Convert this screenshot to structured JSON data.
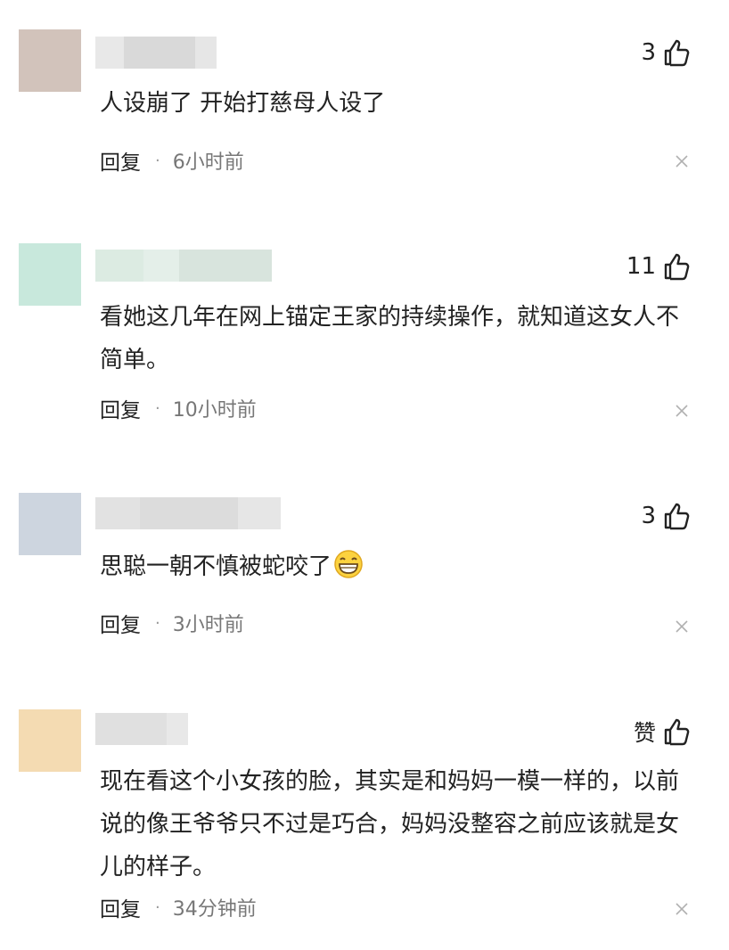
{
  "actions": {
    "reply_label": "回复",
    "separator": "·"
  },
  "comments": [
    {
      "likes": "3",
      "text": "人设崩了 开始打慈母人设了",
      "time": "6小时前",
      "avatar_color": "#d2c3bb"
    },
    {
      "likes": "11",
      "text": "看她这几年在网上锚定王家的持续操作，就知道这女人不简单。",
      "time": "10小时前",
      "avatar_color": "#c8e8dc"
    },
    {
      "likes": "3",
      "text": "思聪一朝不慎被蛇咬了",
      "emoji": "grinning-face-icon",
      "time": "3小时前",
      "avatar_color": "#cdd5df"
    },
    {
      "likes": "赞",
      "text": "现在看这个小女孩的脸，其实是和妈妈一模一样的，以前说的像王爷爷只不过是巧合，妈妈没整容之前应该就是女儿的样子。",
      "time": "34分钟前",
      "avatar_color": "#f4dbb2"
    }
  ]
}
